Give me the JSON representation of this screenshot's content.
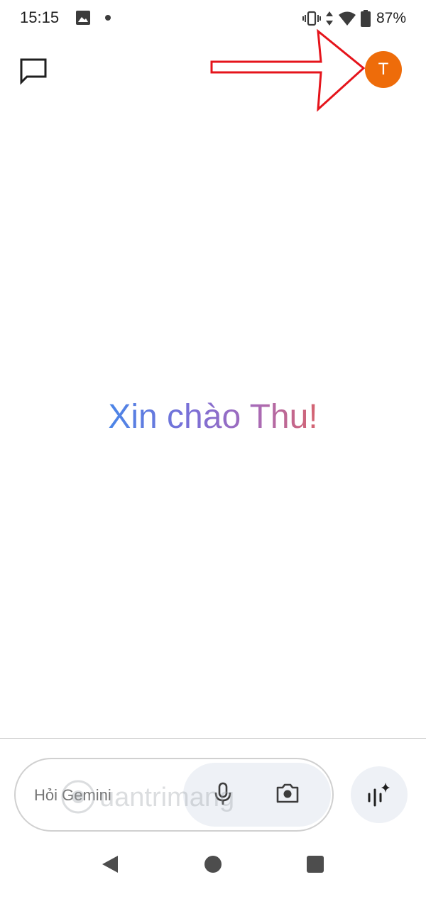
{
  "status_bar": {
    "time": "15:15",
    "battery_percent": "87%",
    "icons": [
      "image-icon",
      "notification-dot-icon",
      "vibrate-icon",
      "data-arrows-icon",
      "wifi-icon",
      "battery-icon"
    ]
  },
  "header": {
    "new_chat_icon": "chat-bubble-icon",
    "avatar_initial": "T",
    "avatar_color": "#ee6c0a"
  },
  "greeting": {
    "text": "Xin chào Thu!"
  },
  "input": {
    "placeholder": "Hỏi Gemini",
    "mic_icon": "microphone-icon",
    "camera_icon": "camera-icon",
    "live_icon": "gemini-live-icon"
  },
  "nav_bar": {
    "icons": [
      "back-icon",
      "home-icon",
      "recent-apps-icon"
    ]
  }
}
